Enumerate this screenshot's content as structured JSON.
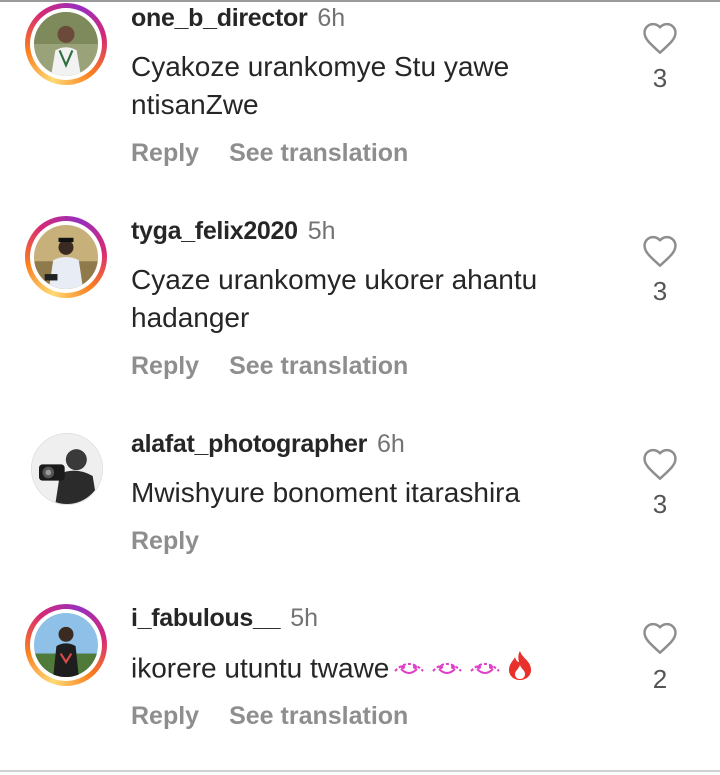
{
  "comments": [
    {
      "username": "one_b_director",
      "time": "6h",
      "text": "Cyakoze urankomye Stu yawe ntisanZwe",
      "reply_label": "Reply",
      "translation_label": "See translation",
      "likes": "3",
      "avatar_ring": "story"
    },
    {
      "username": "tyga_felix2020",
      "time": "5h",
      "text": "Cyaze urankomye ukorer ahantu hadanger",
      "reply_label": "Reply",
      "translation_label": "See translation",
      "likes": "3",
      "avatar_ring": "story"
    },
    {
      "username": "alafat_photographer",
      "time": "6h",
      "text": "Mwishyure bonoment itarashira",
      "reply_label": "Reply",
      "likes": "3",
      "avatar_ring": "none"
    },
    {
      "username": "i_fabulous__",
      "time": "5h",
      "text": "ikorere utuntu twawe",
      "text_emoji": [
        "heart-eyes-emoji",
        "heart-eyes-emoji",
        "heart-eyes-emoji",
        "fire-emoji"
      ],
      "reply_label": "Reply",
      "translation_label": "See translation",
      "likes": "2",
      "avatar_ring": "story"
    }
  ],
  "colors": {
    "text": "#262626",
    "secondary": "#8e8e8e",
    "story_ring": [
      "#feda75",
      "#fa7e1e",
      "#d62976",
      "#962fbf"
    ],
    "emoji_pink": "#e040c8",
    "fire_red": "#e8312a"
  },
  "icons": {
    "like": "heart-outline-icon"
  }
}
